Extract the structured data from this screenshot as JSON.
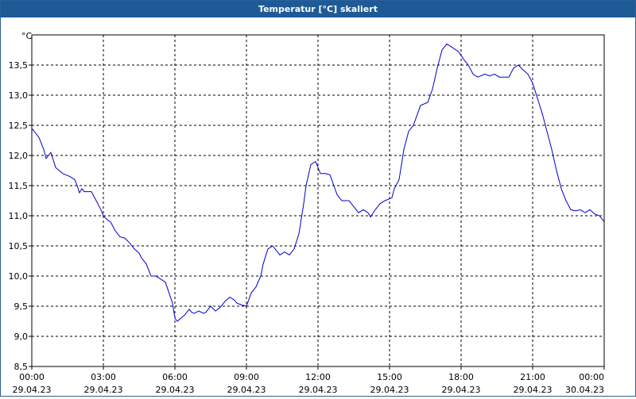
{
  "window": {
    "title": "Temperatur [°C] skaliert"
  },
  "colors": {
    "title_bar": "#1e5a96",
    "line": "#0000cc",
    "grid": "#000000"
  },
  "chart_data": {
    "type": "line",
    "title": "Temperatur [°C] skaliert",
    "ylabel": "°C",
    "xlabel": "",
    "ylim": [
      8.5,
      14.0
    ],
    "yticks": [
      "8,5",
      "9,0",
      "9,5",
      "10,0",
      "10,5",
      "11,0",
      "11,5",
      "12,0",
      "12,5",
      "13,0",
      "13,5"
    ],
    "yticks_values": [
      8.5,
      9.0,
      9.5,
      10.0,
      10.5,
      11.0,
      11.5,
      12.0,
      12.5,
      13.0,
      13.5
    ],
    "xlim_hours": [
      0,
      24
    ],
    "xticks": [
      {
        "time": "00:00",
        "date": "29.04.23"
      },
      {
        "time": "03:00",
        "date": "29.04.23"
      },
      {
        "time": "06:00",
        "date": "29.04.23"
      },
      {
        "time": "09:00",
        "date": "29.04.23"
      },
      {
        "time": "12:00",
        "date": "29.04.23"
      },
      {
        "time": "15:00",
        "date": "29.04.23"
      },
      {
        "time": "18:00",
        "date": "29.04.23"
      },
      {
        "time": "21:00",
        "date": "29.04.23"
      },
      {
        "time": "00:00",
        "date": "30.04.23"
      }
    ],
    "grid": true,
    "series": [
      {
        "x_hours": [
          0.0,
          0.3,
          0.5,
          0.6,
          0.7,
          0.8,
          1.0,
          1.3,
          1.6,
          1.8,
          1.9,
          2.0,
          2.1,
          2.2,
          2.5,
          2.7,
          2.9,
          3.0,
          3.2,
          3.3,
          3.5,
          3.7,
          3.9,
          4.1,
          4.3,
          4.5,
          4.6,
          4.8,
          5.0,
          5.2,
          5.4,
          5.6,
          5.9,
          6.0,
          6.1,
          6.4,
          6.6,
          6.7,
          6.8,
          7.0,
          7.2,
          7.3,
          7.5,
          7.7,
          7.9,
          8.1,
          8.3,
          8.5,
          8.6,
          8.8,
          9.0,
          9.2,
          9.4,
          9.6,
          9.7,
          9.9,
          10.1,
          10.3,
          10.4,
          10.6,
          10.8,
          11.0,
          11.2,
          11.4,
          11.5,
          11.7,
          11.9,
          12.1,
          12.3,
          12.5,
          12.8,
          13.0,
          13.3,
          13.5,
          13.7,
          13.9,
          14.1,
          14.2,
          14.4,
          14.6,
          14.8,
          15.0,
          15.1,
          15.2,
          15.4,
          15.6,
          15.8,
          16.0,
          16.3,
          16.6,
          16.8,
          17.0,
          17.2,
          17.4,
          17.6,
          17.9,
          18.1,
          18.3,
          18.5,
          18.7,
          19.0,
          19.2,
          19.4,
          19.6,
          19.8,
          20.0,
          20.2,
          20.4,
          20.6,
          20.8,
          21.0,
          21.2,
          21.4,
          21.6,
          21.8,
          22.0,
          22.2,
          22.4,
          22.6,
          22.8,
          23.0,
          23.2,
          23.4,
          23.6,
          23.8,
          24.0
        ],
        "values": [
          12.45,
          12.3,
          12.1,
          11.95,
          12.0,
          12.05,
          11.8,
          11.7,
          11.65,
          11.6,
          11.5,
          11.38,
          11.45,
          11.4,
          11.4,
          11.25,
          11.1,
          11.0,
          10.92,
          10.9,
          10.75,
          10.65,
          10.63,
          10.55,
          10.45,
          10.38,
          10.3,
          10.2,
          10.0,
          10.0,
          9.95,
          9.9,
          9.55,
          9.3,
          9.25,
          9.35,
          9.45,
          9.4,
          9.38,
          9.42,
          9.38,
          9.4,
          9.5,
          9.42,
          9.48,
          9.58,
          9.65,
          9.6,
          9.55,
          9.52,
          9.5,
          9.72,
          9.82,
          10.0,
          10.2,
          10.45,
          10.5,
          10.4,
          10.35,
          10.4,
          10.35,
          10.45,
          10.7,
          11.2,
          11.5,
          11.85,
          11.9,
          11.7,
          11.7,
          11.68,
          11.35,
          11.25,
          11.25,
          11.15,
          11.05,
          11.1,
          11.05,
          10.98,
          11.1,
          11.2,
          11.25,
          11.28,
          11.3,
          11.45,
          11.6,
          12.1,
          12.4,
          12.5,
          12.83,
          12.88,
          13.1,
          13.45,
          13.75,
          13.85,
          13.8,
          13.72,
          13.6,
          13.5,
          13.35,
          13.3,
          13.35,
          13.32,
          13.35,
          13.3,
          13.3,
          13.3,
          13.45,
          13.5,
          13.42,
          13.35,
          13.2,
          12.95,
          12.7,
          12.4,
          12.1,
          11.75,
          11.45,
          11.25,
          11.1,
          11.08,
          11.1,
          11.05,
          11.1,
          11.03,
          11.0,
          10.9
        ]
      }
    ]
  }
}
